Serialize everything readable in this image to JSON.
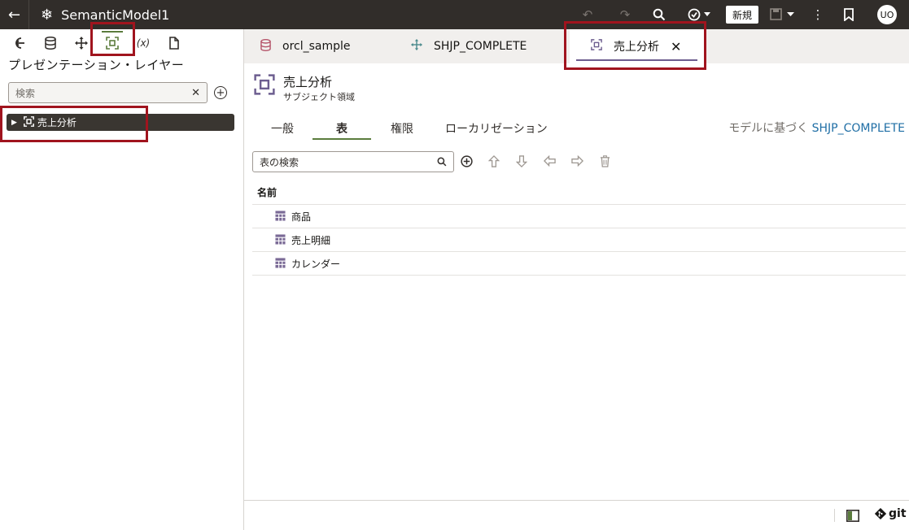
{
  "header": {
    "title": "SemanticModel1",
    "new_label": "新規",
    "avatar": "UO"
  },
  "left": {
    "heading": "プレゼンテーション・レイヤー",
    "search_placeholder": "検索",
    "tree": [
      {
        "label": "売上分析",
        "expanded": false
      }
    ]
  },
  "tabs": [
    {
      "label": "orcl_sample",
      "icon": "database-icon"
    },
    {
      "label": "SHJP_COMPLETE",
      "icon": "move-icon"
    },
    {
      "label": "売上分析",
      "icon": "subject-area-icon",
      "active": true
    }
  ],
  "main": {
    "title": "売上分析",
    "subtitle": "サブジェクト領域",
    "subtabs": [
      "一般",
      "表",
      "権限",
      "ローカリゼーション"
    ],
    "active_subtab": "表",
    "based_on_label": "モデルに基づく",
    "based_on_link": "SHJP_COMPLETE",
    "table_search_placeholder": "表の検索",
    "column_header": "名前",
    "rows": [
      "商品",
      "売上明細",
      "カレンダー"
    ]
  },
  "footer": {
    "git_label": "git"
  },
  "colors": {
    "topbar": "#312d2a",
    "accent_green": "#5b7c3d",
    "accent_purple": "#6c5d8f",
    "link": "#1f6ea5",
    "highlight": "#a0141e"
  }
}
